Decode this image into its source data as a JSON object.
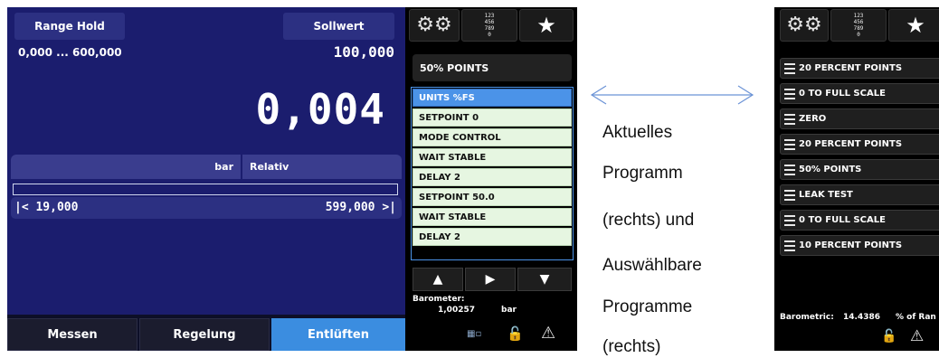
{
  "main": {
    "range_hold_label": "Range Hold",
    "setpoint_label": "Sollwert",
    "range_text": "0,000 ... 600,000",
    "setpoint_value": "100,000",
    "reading": "0,004",
    "unit": "bar",
    "mode": "Relativ",
    "low_limit": "|<  19,000",
    "high_limit": "599,000  >|",
    "progress_fraction": 0.0,
    "tabs": [
      "Messen",
      "Regelung",
      "Entlüften"
    ],
    "active_tab": "Entlüften"
  },
  "sidebar": {
    "icons": [
      "settings-gears-icon",
      "keypad-icon",
      "favorite-star-icon"
    ],
    "keypad_glyph": "123\n456\n789\n0",
    "current_program": "50% POINTS",
    "steps": [
      {
        "label": "UNITS %FS",
        "active": true
      },
      {
        "label": "SETPOINT 0",
        "active": false
      },
      {
        "label": "MODE CONTROL",
        "active": false
      },
      {
        "label": "WAIT STABLE",
        "active": false
      },
      {
        "label": "DELAY 2",
        "active": false
      },
      {
        "label": "SETPOINT 50.0",
        "active": false
      },
      {
        "label": "WAIT STABLE",
        "active": false
      },
      {
        "label": "DELAY 2",
        "active": false
      }
    ],
    "nav_arrows": [
      "▲",
      "▶",
      "▼"
    ],
    "barometer_label": "Barometer:",
    "barometer_value": "1,00257",
    "barometer_unit": "bar"
  },
  "annotation": {
    "lines": [
      "Aktuelles",
      "Programm",
      "(rechts) und",
      "Auswählbare",
      "Programme",
      "(rechts)"
    ]
  },
  "right_screen": {
    "programs": [
      "20 PERCENT POINTS",
      "0 TO FULL SCALE",
      "ZERO",
      "20 PERCENT POINTS",
      "50% POINTS",
      "LEAK TEST",
      "0 TO FULL SCALE",
      "10 PERCENT POINTS"
    ],
    "barometric_label": "Barometric:",
    "barometric_value": "14.4386",
    "pct_label": "% of Ran"
  },
  "colors": {
    "panel_blue": "#1b1d6e",
    "active_tab_blue": "#3b8de0",
    "step_green": "#e6f6e1",
    "step_active_blue": "#4b93e8",
    "annotation_arrow": "#6b93d6"
  }
}
